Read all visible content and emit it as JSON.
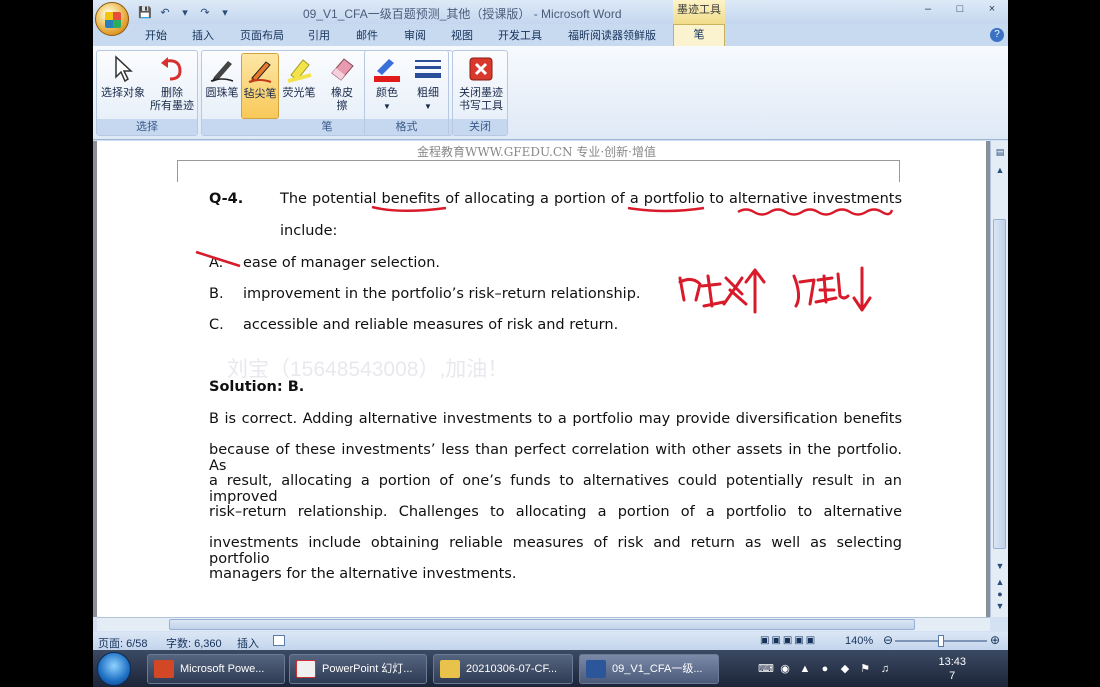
{
  "window": {
    "title": "09_V1_CFA一级百题预测_其他（授课版） - Microsoft Word",
    "context_tab_title": "墨迹工具",
    "controls": [
      "–",
      "□",
      "×"
    ]
  },
  "ribbon_tabs": [
    "开始",
    "插入",
    "页面布局",
    "引用",
    "邮件",
    "审阅",
    "视图",
    "开发工具",
    "福昕阅读器领鲜版"
  ],
  "active_tab": "笔",
  "ribbon": {
    "groups": {
      "select": "选择",
      "pen": "笔",
      "format": "格式",
      "close": "关闭"
    },
    "buttons": {
      "select_object": "选择对象",
      "delete_ink_l1": "删除",
      "delete_ink_l2": "所有墨迹",
      "ballpoint": "圆珠笔",
      "felt_tip": "毡尖笔",
      "highlighter": "荧光笔",
      "eraser_l1": "橡皮",
      "eraser_l2": "擦",
      "color": "颜色",
      "weight": "粗细",
      "close_l1": "关闭墨迹",
      "close_l2": "书写工具"
    }
  },
  "document": {
    "header": "金程教育WWW.GFEDU.CN 专业·创新·增值",
    "question_number": "Q-4.",
    "question_line1": "The potential benefits of allocating a portion of a portfolio to alternative investments",
    "question_line2": "include:",
    "options": [
      {
        "letter": "A.",
        "text": "ease of manager selection."
      },
      {
        "letter": "B.",
        "text": "improvement in the portfolio’s risk–return relationship."
      },
      {
        "letter": "C.",
        "text": "accessible and reliable measures of risk and return."
      }
    ],
    "watermark": "刘宝（15648543008）,加油！",
    "solution_title": "Solution: B.",
    "solution_lines": [
      "B is correct. Adding alternative investments to a portfolio may provide diversification benefits",
      "because of these investments’ less than perfect correlation with other assets in the portfolio. As",
      "a result, allocating a portion of one’s funds to alternatives could potentially result in an improved",
      "risk–return relationship. Challenges to allocating a portion of a portfolio to alternative",
      "investments include obtaining reliable measures of risk and return as well as selecting portfolio",
      "managers for the alternative investments."
    ],
    "handwritten_note": "收益↑ 风险↓"
  },
  "statusbar": {
    "page": "页面: 6/58",
    "words": "字数: 6,360",
    "mode": "插入",
    "zoom": "140%",
    "zoom_fraction": 0.5
  },
  "taskbar": {
    "tasks": [
      "Microsoft Powe...",
      "PowerPoint 幻灯...",
      "20210306-07-CF...",
      "09_V1_CFA一级..."
    ],
    "time": "13:43",
    "date_line": "7"
  },
  "colors": {
    "ink_red": "#d81a2a",
    "ribbon_bg": "#dfe9f6",
    "taskbar_bg": "#1c2538"
  }
}
